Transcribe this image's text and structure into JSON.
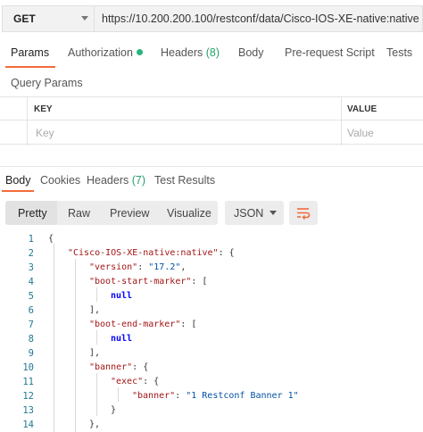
{
  "request": {
    "method": "GET",
    "url": "https://10.200.200.100/restconf/data/Cisco-IOS-XE-native:native"
  },
  "request_tabs": {
    "params": "Params",
    "authorization": "Authorization",
    "headers": "Headers",
    "headers_count": "(8)",
    "body": "Body",
    "pre_request": "Pre-request Script",
    "tests": "Tests"
  },
  "query_params": {
    "title": "Query Params",
    "columns": [
      "KEY",
      "VALUE"
    ],
    "key_placeholder": "Key",
    "value_placeholder": "Value"
  },
  "response_tabs": {
    "body": "Body",
    "cookies": "Cookies",
    "headers": "Headers",
    "headers_count": "(7)",
    "test_results": "Test Results"
  },
  "toolbar": {
    "pretty": "Pretty",
    "raw": "Raw",
    "preview": "Preview",
    "visualize": "Visualize",
    "format": "JSON"
  },
  "code": {
    "line_numbers": [
      "1",
      "2",
      "3",
      "4",
      "5",
      "6",
      "7",
      "8",
      "9",
      "10",
      "11",
      "12",
      "13",
      "14"
    ],
    "l1": "{",
    "l2_key": "\"Cisco-IOS-XE-native:native\"",
    "l2_rest": ": {",
    "l3_key": "\"version\"",
    "l3_sep": ": ",
    "l3_val": "\"17.2\"",
    "l3_end": ",",
    "l4_key": "\"boot-start-marker\"",
    "l4_rest": ": [",
    "l5": "null",
    "l6": "],",
    "l7_key": "\"boot-end-marker\"",
    "l7_rest": ": [",
    "l8": "null",
    "l9": "],",
    "l10_key": "\"banner\"",
    "l10_rest": ": {",
    "l11_key": "\"exec\"",
    "l11_rest": ": {",
    "l12_key": "\"banner\"",
    "l12_sep": ": ",
    "l12_val": "\"1 Restconf Banner 1\"",
    "l13": "}",
    "l14": "},"
  },
  "colors": {
    "accent": "#f26b3a",
    "auth_dot": "#26b47f",
    "json_key": "#a31515",
    "json_string": "#0451a5",
    "json_null": "#0000ff"
  }
}
